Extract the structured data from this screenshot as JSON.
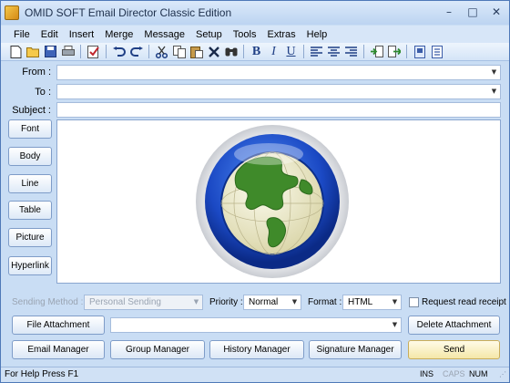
{
  "window": {
    "title": "OMID SOFT Email Director Classic Edition"
  },
  "window_controls": {
    "minimize": "–",
    "maximize": "□",
    "close": "✕"
  },
  "menu": [
    "File",
    "Edit",
    "Insert",
    "Merge",
    "Message",
    "Setup",
    "Tools",
    "Extras",
    "Help"
  ],
  "toolbar": {
    "icons": [
      "new-doc-icon",
      "open-folder-icon",
      "save-icon",
      "print-icon",
      "spellcheck-icon",
      "undo-icon",
      "redo-icon",
      "cut-icon",
      "copy-icon",
      "paste-icon",
      "delete-icon",
      "find-icon",
      "bold-icon",
      "italic-icon",
      "underline-icon",
      "align-left-icon",
      "align-center-icon",
      "align-right-icon",
      "insert-field-icon",
      "export-icon",
      "attach-doc-icon",
      "settings-doc-icon"
    ],
    "bold": "B",
    "italic": "I",
    "underline": "U"
  },
  "header_fields": {
    "from_label": "From :",
    "from_value": "",
    "to_label": "To :",
    "to_value": "",
    "subject_label": "Subject :",
    "subject_value": ""
  },
  "side_buttons": [
    "Font",
    "Body",
    "Line",
    "Table",
    "Picture",
    "Hyperlink"
  ],
  "options": {
    "sending_method_label": "Sending Method :",
    "sending_method_value": "Personal Sending",
    "priority_label": "Priority :",
    "priority_value": "Normal",
    "format_label": "Format :",
    "format_value": "HTML",
    "read_receipt_label": "Request read receipt",
    "read_receipt_checked": false
  },
  "attachment": {
    "file_attachment_button": "File Attachment",
    "delete_attachment_button": "Delete Attachment",
    "value": ""
  },
  "actions": {
    "email_manager": "Email Manager",
    "group_manager": "Group Manager",
    "history_manager": "History Manager",
    "signature_manager": "Signature Manager",
    "send": "Send"
  },
  "status": {
    "help": "For Help Press F1",
    "ins": "INS",
    "caps": "CAPS",
    "num": "NUM"
  },
  "colors": {
    "accent": "#1f56c9",
    "globe_land": "#3f8a2a",
    "globe_ocean": "#f4f1d6"
  }
}
